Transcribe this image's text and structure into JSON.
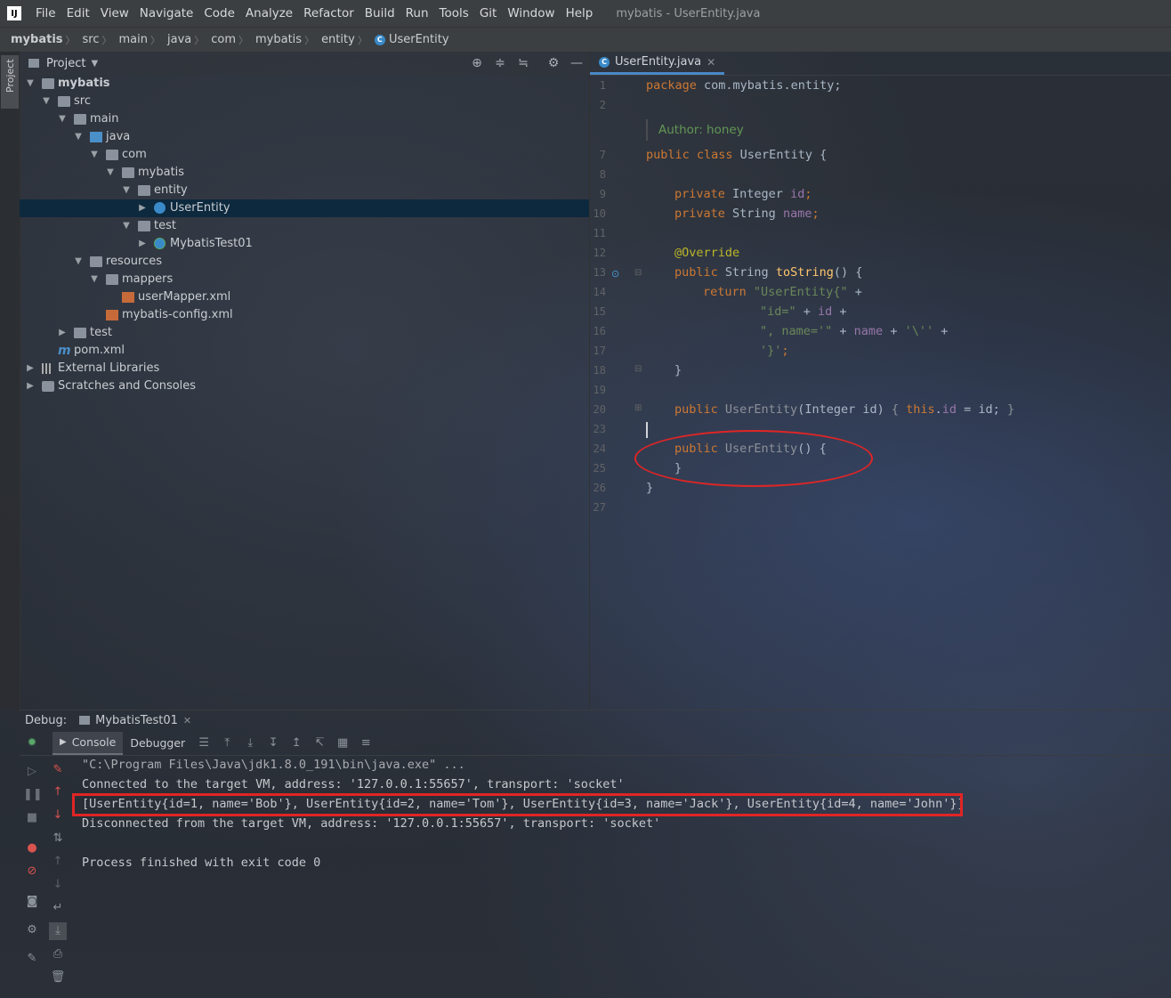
{
  "menubar": {
    "logo": "IJ",
    "items": [
      "File",
      "Edit",
      "View",
      "Navigate",
      "Code",
      "Analyze",
      "Refactor",
      "Build",
      "Run",
      "Tools",
      "Git",
      "Window",
      "Help"
    ],
    "window_title": "mybatis - UserEntity.java"
  },
  "breadcrumb": [
    "mybatis",
    "src",
    "main",
    "java",
    "com",
    "mybatis",
    "entity",
    "UserEntity"
  ],
  "left_stripe": {
    "project_label": "Project"
  },
  "project": {
    "title": "Project",
    "tree": [
      {
        "label": "mybatis",
        "bold": true,
        "expanded": true,
        "icon": "module-folder-icon"
      },
      {
        "label": "src",
        "expanded": true,
        "icon": "folder-icon"
      },
      {
        "label": "main",
        "expanded": true,
        "icon": "folder-icon"
      },
      {
        "label": "java",
        "expanded": true,
        "icon": "source-folder-icon"
      },
      {
        "label": "com",
        "expanded": true,
        "icon": "package-icon"
      },
      {
        "label": "mybatis",
        "expanded": true,
        "icon": "package-icon"
      },
      {
        "label": "entity",
        "expanded": true,
        "icon": "package-icon"
      },
      {
        "label": "UserEntity",
        "expanded": false,
        "icon": "class-icon",
        "selected": true
      },
      {
        "label": "test",
        "expanded": true,
        "icon": "package-icon"
      },
      {
        "label": "MybatisTest01",
        "expanded": false,
        "icon": "test-class-icon"
      },
      {
        "label": "resources",
        "expanded": true,
        "icon": "resources-folder-icon"
      },
      {
        "label": "mappers",
        "expanded": true,
        "icon": "folder-icon"
      },
      {
        "label": "userMapper.xml",
        "icon": "xml-file-icon"
      },
      {
        "label": "mybatis-config.xml",
        "icon": "xml-file-icon"
      },
      {
        "label": "test",
        "expanded": false,
        "icon": "folder-icon"
      },
      {
        "label": "pom.xml",
        "icon": "maven-icon"
      },
      {
        "label": "External Libraries",
        "expanded": false,
        "icon": "libraries-icon"
      },
      {
        "label": "Scratches and Consoles",
        "expanded": false,
        "icon": "scratches-icon"
      }
    ]
  },
  "editor": {
    "tab_label": "UserEntity.java",
    "line_numbers": [
      "1",
      "2",
      "7",
      "8",
      "9",
      "10",
      "11",
      "12",
      "13",
      "14",
      "15",
      "16",
      "17",
      "18",
      "19",
      "20",
      "23",
      "24",
      "25",
      "26",
      "27"
    ],
    "code": {
      "l1_kw": "package",
      "l1_rest": " com.mybatis.entity;",
      "author": "Author: honey",
      "l7_kw": "public class",
      "l7_rest": " UserEntity {",
      "l9_kw": "private",
      "l9_type": " Integer ",
      "l9_field": "id",
      "l10_kw": "private",
      "l10_type": " String ",
      "l10_field": "name",
      "l12_ann": "@Override",
      "l13_kw": "public",
      "l13_type": " String ",
      "l13_fn": "toString",
      "l13_rest": "() {",
      "l14_kw": "return",
      "l14_str": " \"UserEntity{\"",
      "l14_rest": " +",
      "l15_str": "\"id=\"",
      "l15_mid": " + ",
      "l15_field": "id",
      "l15_rest": " +",
      "l16_str": "\", name='\"",
      "l16_mid": " + ",
      "l16_field": "name",
      "l16_mid2": " + ",
      "l16_str2": "'\\''",
      "l16_rest": " +",
      "l17_str": "'}'",
      "l17_rest": ";",
      "l18": "}",
      "l20_kw": "public",
      "l20_ctor": " UserEntity",
      "l20_params": "(Integer id) ",
      "l20_brace_open": "{",
      "l20_this": " this",
      "l20_dot": ".",
      "l20_field": "id",
      "l20_assign": " = id; ",
      "l20_brace_close": "}",
      "l24_kw": "public",
      "l24_ctor": " UserEntity",
      "l24_rest": "() {",
      "l25": "}",
      "l26": "}"
    }
  },
  "debug": {
    "label": "Debug:",
    "session_tab": "MybatisTest01",
    "tabs": [
      "Console",
      "Debugger"
    ],
    "console_lines": [
      "\"C:\\Program Files\\Java\\jdk1.8.0_191\\bin\\java.exe\" ...",
      "Connected to the target VM, address: '127.0.0.1:55657', transport: 'socket'",
      "[UserEntity{id=1, name='Bob'}, UserEntity{id=2, name='Tom'}, UserEntity{id=3, name='Jack'}, UserEntity{id=4, name='John'}]",
      "Disconnected from the target VM, address: '127.0.0.1:55657', transport: 'socket'",
      "Process finished with exit code 0"
    ]
  },
  "colors": {
    "keyword": "#cc7832",
    "string": "#6a8759",
    "field": "#9876aa",
    "method": "#ffc66d",
    "annotation": "#bbb529",
    "highlight_red": "#e02525",
    "selection": "#0d293e"
  }
}
